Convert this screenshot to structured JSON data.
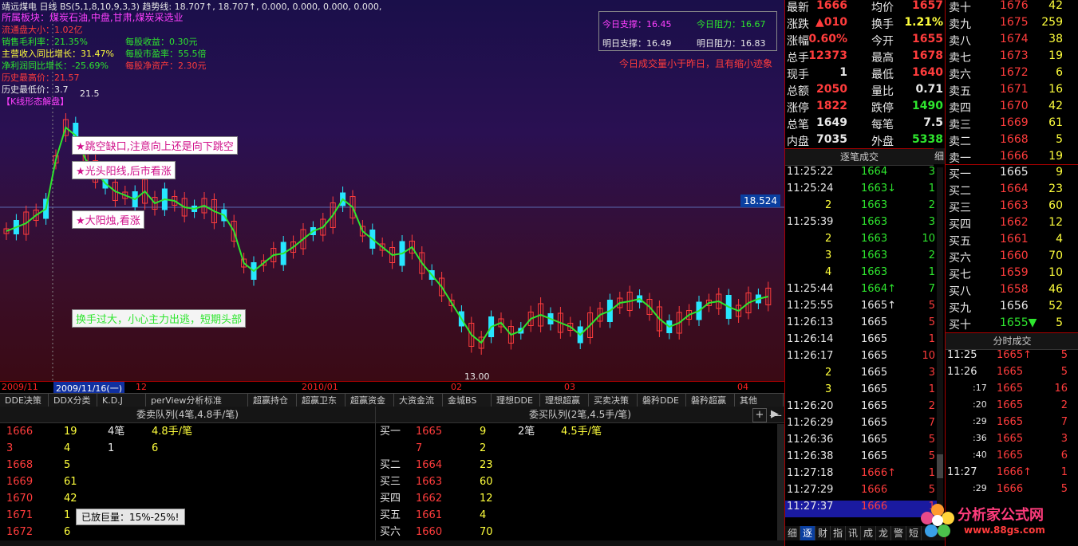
{
  "chart_header": {
    "line1": "靖远煤电 日线 BS(5,1,8,10,9,3,3) 趋势线: 18.707↑, 18.707↑, 0.000, 0.000, 0.000, 0.000,",
    "sector": "所属板块：煤炭石油,中盘,甘肃,煤炭采选业",
    "float": "流通盘大小：1.02亿",
    "margin_label": "销售毛利率：21.35%",
    "eps_label": "每股收益：0.30元",
    "rev_label": "主营收入同比增长：31.47%",
    "pe_label": "每股市盈率：55.5倍",
    "profit_label": "净利润同比增长：-25.69%",
    "nav_label": "每股净资产：2.30元",
    "high_label": "历史最高价：21.57",
    "low_label": "历史最低价：3.7",
    "pattern_label": "【K线形态解盘】",
    "peak_label": "21.5",
    "bottom_label": "13.00",
    "support_today": "今日支撑：16.45",
    "resist_today": "今日阻力：16.67",
    "support_tomorrow": "明日支撑：16.49",
    "resist_tomorrow": "明日阻力：16.83",
    "volume_note": "今日成交量小于昨日，且有缩小迹象",
    "price_tag": "18.524",
    "callouts": [
      "★跳空缺口,注意向上还是向下跳空",
      "★光头阳线,后市看涨",
      "★大阳烛,看涨",
      "换手过大，小心主力出逃，短期头部"
    ],
    "marks": {
      "s": "S",
      "b": "B"
    }
  },
  "x_axis": [
    "2009/11",
    "2009/11/16(一)",
    "12",
    "2010/01",
    "02",
    "03",
    "04"
  ],
  "tabs": [
    "DDE决策",
    "DDX分类",
    "K.D.J",
    "perView分析",
    "标准",
    "超赢持仓",
    "超赢卫东",
    "超赢资金",
    "大资金流",
    "金城BS",
    "理想DDE",
    "理想超赢",
    "买卖决策",
    "磐矜DDE",
    "磐矜超赢",
    "其他"
  ],
  "sell_queue": {
    "title": "委卖队列(4笔,4.8手/笔)",
    "rows": [
      {
        "price": "1666",
        "a": "19",
        "b": "4笔",
        "c": "4.8手/笔"
      },
      {
        "price": "3",
        "a": "4",
        "b": "1",
        "c": "6"
      },
      {
        "price": "1668",
        "a": "5",
        "b": "",
        "c": ""
      },
      {
        "price": "1669",
        "a": "61",
        "b": "",
        "c": ""
      },
      {
        "price": "1670",
        "a": "42",
        "b": "",
        "c": ""
      },
      {
        "price": "1671",
        "a": "1",
        "b": "",
        "c": ""
      },
      {
        "price": "1672",
        "a": "6",
        "b": "",
        "c": ""
      }
    ],
    "tooltip": "已放巨量：15%-25%!"
  },
  "buy_queue": {
    "title": "委买队列(2笔,4.5手/笔)",
    "rows": [
      {
        "label": "买一",
        "price": "1665",
        "a": "9",
        "b": "2笔",
        "c": "4.5手/笔"
      },
      {
        "label": "",
        "price": "7",
        "a": "2",
        "b": "",
        "c": ""
      },
      {
        "label": "买二",
        "price": "1664",
        "a": "23",
        "b": "",
        "c": ""
      },
      {
        "label": "买三",
        "price": "1663",
        "a": "60",
        "b": "",
        "c": ""
      },
      {
        "label": "买四",
        "price": "1662",
        "a": "12",
        "b": "",
        "c": ""
      },
      {
        "label": "买五",
        "price": "1661",
        "a": "4",
        "b": "",
        "c": ""
      },
      {
        "label": "买六",
        "price": "1660",
        "a": "70",
        "b": "",
        "c": ""
      }
    ]
  },
  "quote": [
    [
      "最新",
      "1666",
      "均价",
      "1657"
    ],
    [
      "涨跌",
      "▲010",
      "换手",
      "1.21%"
    ],
    [
      "涨幅",
      "0.60%",
      "今开",
      "1655"
    ],
    [
      "总手",
      "12373",
      "最高",
      "1678"
    ],
    [
      "现手",
      "1",
      "最低",
      "1640"
    ],
    [
      "总额",
      "2050",
      "量比",
      "0.71"
    ],
    [
      "涨停",
      "1822",
      "跌停",
      "1490"
    ],
    [
      "总笔",
      "1649",
      "每笔",
      "7.5"
    ],
    [
      "内盘",
      "7035",
      "外盘",
      "5338"
    ]
  ],
  "tick_title": "逐笔成交",
  "tick_detail": "细",
  "ticks": [
    [
      "11:25:22",
      "1664",
      "3"
    ],
    [
      "11:25:24",
      "1663↓",
      "1"
    ],
    [
      "2",
      "1663",
      "2"
    ],
    [
      "11:25:39",
      "1663",
      "3"
    ],
    [
      "2",
      "1663",
      "10"
    ],
    [
      "3",
      "1663",
      "2"
    ],
    [
      "4",
      "1663",
      "1"
    ],
    [
      "11:25:44",
      "1664↑",
      "7"
    ],
    [
      "11:25:55",
      "1665↑",
      "5"
    ],
    [
      "11:26:13",
      "1665",
      "5"
    ],
    [
      "11:26:14",
      "1665",
      "1"
    ],
    [
      "11:26:17",
      "1665",
      "10"
    ],
    [
      "2",
      "1665",
      "3"
    ],
    [
      "3",
      "1665",
      "1"
    ],
    [
      "11:26:20",
      "1665",
      "2"
    ],
    [
      "11:26:29",
      "1665",
      "7"
    ],
    [
      "11:26:36",
      "1665",
      "5"
    ],
    [
      "11:26:38",
      "1665",
      "5"
    ],
    [
      "11:27:18",
      "1666↑",
      "1"
    ],
    [
      "11:27:29",
      "1666",
      "5"
    ],
    [
      "11:27:37",
      "1666",
      "1"
    ]
  ],
  "bottom_tabs": [
    "细",
    "逐",
    "财",
    "指",
    "讯",
    "成",
    "龙",
    "警",
    "短"
  ],
  "asks": [
    [
      "卖十",
      "1676",
      "42"
    ],
    [
      "卖九",
      "1675",
      "259"
    ],
    [
      "卖八",
      "1674",
      "38"
    ],
    [
      "卖七",
      "1673",
      "19"
    ],
    [
      "卖六",
      "1672",
      "6"
    ],
    [
      "卖五",
      "1671",
      "16"
    ],
    [
      "卖四",
      "1670",
      "42"
    ],
    [
      "卖三",
      "1669",
      "61"
    ],
    [
      "卖二",
      "1668",
      "5"
    ],
    [
      "卖一",
      "1666",
      "19"
    ]
  ],
  "bids": [
    [
      "买一",
      "1665",
      "9"
    ],
    [
      "买二",
      "1664",
      "23"
    ],
    [
      "买三",
      "1663",
      "60"
    ],
    [
      "买四",
      "1662",
      "12"
    ],
    [
      "买五",
      "1661",
      "4"
    ],
    [
      "买六",
      "1660",
      "70"
    ],
    [
      "买七",
      "1659",
      "10"
    ],
    [
      "买八",
      "1658",
      "46"
    ],
    [
      "买九",
      "1656",
      "52"
    ],
    [
      "买十",
      "1655▼",
      "5"
    ]
  ],
  "minute_title": "分时成交",
  "minute": [
    [
      "11:25",
      "1665↑",
      "5"
    ],
    [
      "11:26",
      "1665",
      "5"
    ],
    [
      ":17",
      "1665",
      "16"
    ],
    [
      ":20",
      "1665",
      "2"
    ],
    [
      ":29",
      "1665",
      "7"
    ],
    [
      ":36",
      "1665",
      "3"
    ],
    [
      ":40",
      "1665",
      "6"
    ],
    [
      "11:27",
      "1666↑",
      "1"
    ],
    [
      ":29",
      "1666",
      "5"
    ]
  ],
  "logo": {
    "title": "分析家公式网",
    "url": "www.88gs.com"
  },
  "colors": {
    "up": "#ff3c3c",
    "down": "#2ee62e",
    "flat": "#e8e8e8",
    "accent": "#ffff3c"
  }
}
